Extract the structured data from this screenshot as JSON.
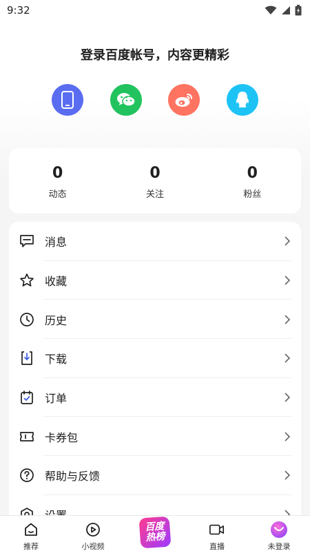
{
  "status": {
    "time": "9:32"
  },
  "login": {
    "title": "登录百度帐号，内容更精彩",
    "methods": [
      {
        "icon": "phone-icon",
        "color": "#5a6df0"
      },
      {
        "icon": "wechat-icon",
        "color": "#22c35e"
      },
      {
        "icon": "weibo-icon",
        "color": "#ff7361"
      },
      {
        "icon": "qq-icon",
        "color": "#1ec3f5"
      }
    ]
  },
  "stats": [
    {
      "value": "0",
      "label": "动态"
    },
    {
      "value": "0",
      "label": "关注"
    },
    {
      "value": "0",
      "label": "粉丝"
    }
  ],
  "menu": [
    {
      "label": "消息",
      "icon": "message-icon"
    },
    {
      "label": "收藏",
      "icon": "star-icon"
    },
    {
      "label": "历史",
      "icon": "clock-icon"
    },
    {
      "label": "下载",
      "icon": "download-icon"
    },
    {
      "label": "订单",
      "icon": "order-icon"
    },
    {
      "label": "卡券包",
      "icon": "coupon-icon"
    },
    {
      "label": "帮助与反馈",
      "icon": "help-icon"
    },
    {
      "label": "设置",
      "icon": "settings-icon"
    }
  ],
  "tabbar": {
    "tabs": [
      {
        "label": "推荐",
        "icon": "home-icon"
      },
      {
        "label": "小视频",
        "icon": "video-play-icon"
      },
      {
        "label": "",
        "icon": "baidu-hot-list-icon",
        "badge_lines": [
          "百度",
          "热榜"
        ]
      },
      {
        "label": "直播",
        "icon": "live-camera-icon"
      },
      {
        "label": "未登录",
        "icon": "avatar-icon"
      }
    ]
  }
}
